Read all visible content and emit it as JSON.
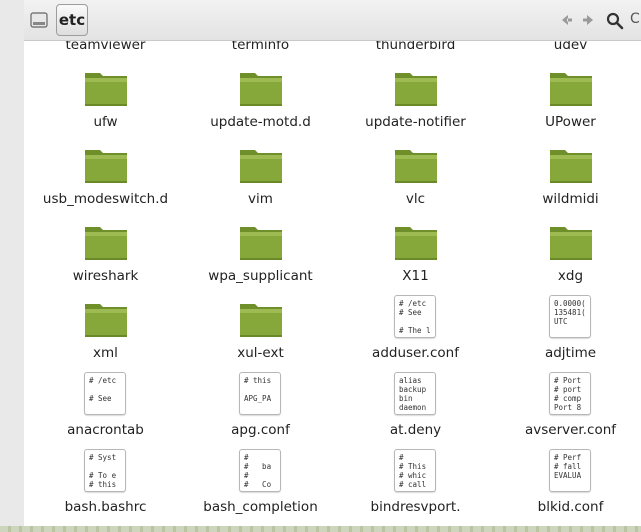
{
  "window": {
    "current_folder": "etc",
    "search_label_partial": "C"
  },
  "icons": {
    "drive": "drive-icon",
    "back": "arrow-left-icon",
    "forward": "arrow-right-icon",
    "search": "search-icon"
  },
  "colors": {
    "folder_body": "#86a73a",
    "folder_tab": "#6f8f2a",
    "accent_bottom": "#b8c4a2"
  },
  "files": [
    {
      "name": "teamviewer",
      "type": "folder"
    },
    {
      "name": "terminfo",
      "type": "folder"
    },
    {
      "name": "thunderbird",
      "type": "folder"
    },
    {
      "name": "udev",
      "type": "folder"
    },
    {
      "name": "ufw",
      "type": "folder"
    },
    {
      "name": "update-motd.d",
      "type": "folder"
    },
    {
      "name": "update-notifier",
      "type": "folder"
    },
    {
      "name": "UPower",
      "type": "folder"
    },
    {
      "name": "usb_modeswitch.d",
      "type": "folder"
    },
    {
      "name": "vim",
      "type": "folder"
    },
    {
      "name": "vlc",
      "type": "folder"
    },
    {
      "name": "wildmidi",
      "type": "folder"
    },
    {
      "name": "wireshark",
      "type": "folder"
    },
    {
      "name": "wpa_supplicant",
      "type": "folder"
    },
    {
      "name": "X11",
      "type": "folder"
    },
    {
      "name": "xdg",
      "type": "folder"
    },
    {
      "name": "xml",
      "type": "folder"
    },
    {
      "name": "xul-ext",
      "type": "folder"
    },
    {
      "name": "adduser.conf",
      "type": "text",
      "preview": "# /etc\n# See \n\n# The l"
    },
    {
      "name": "adjtime",
      "type": "text",
      "preview": "0.0000(\n135481(\nUTC"
    },
    {
      "name": "anacrontab",
      "type": "text",
      "preview": "# /etc\n\n# See "
    },
    {
      "name": "apg.conf",
      "type": "text",
      "preview": "# this\n\nAPG_PA"
    },
    {
      "name": "at.deny",
      "type": "text",
      "preview": "alias\nbackup\nbin\ndaemon"
    },
    {
      "name": "avserver.conf",
      "type": "text",
      "preview": "# Port\n# port\n# comp\nPort 8"
    },
    {
      "name": "bash.bashrc",
      "type": "text",
      "preview": "# Syst\n\n# To e\n# this"
    },
    {
      "name": "bash_completion",
      "type": "text",
      "preview": "#\n#   ba\n#\n#   Co"
    },
    {
      "name": "bindresvport.",
      "type": "text",
      "preview": "#\n# This\n# whic\n# call"
    },
    {
      "name": "blkid.conf",
      "type": "text",
      "preview": "# Perf\n# fall\nEVALUA"
    }
  ]
}
